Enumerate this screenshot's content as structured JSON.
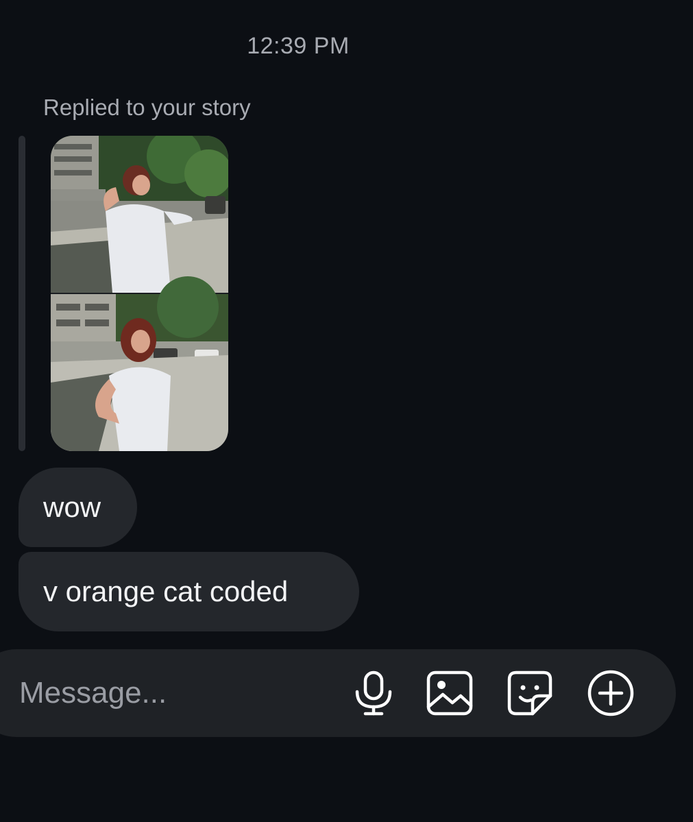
{
  "timestamp": "12:39 PM",
  "reply": {
    "label": "Replied to your story",
    "story_thumbnail": "story-photo-collage"
  },
  "messages": [
    {
      "text": "wow"
    },
    {
      "text": "v orange cat coded"
    }
  ],
  "composer": {
    "placeholder": "Message...",
    "icons": [
      "microphone-icon",
      "image-icon",
      "sticker-icon",
      "plus-icon"
    ]
  },
  "colors": {
    "background": "#0c0f14",
    "bubble": "#24272c",
    "composer": "#1f2226",
    "muted_text": "#a8abb2",
    "text": "#f3f4f6"
  }
}
